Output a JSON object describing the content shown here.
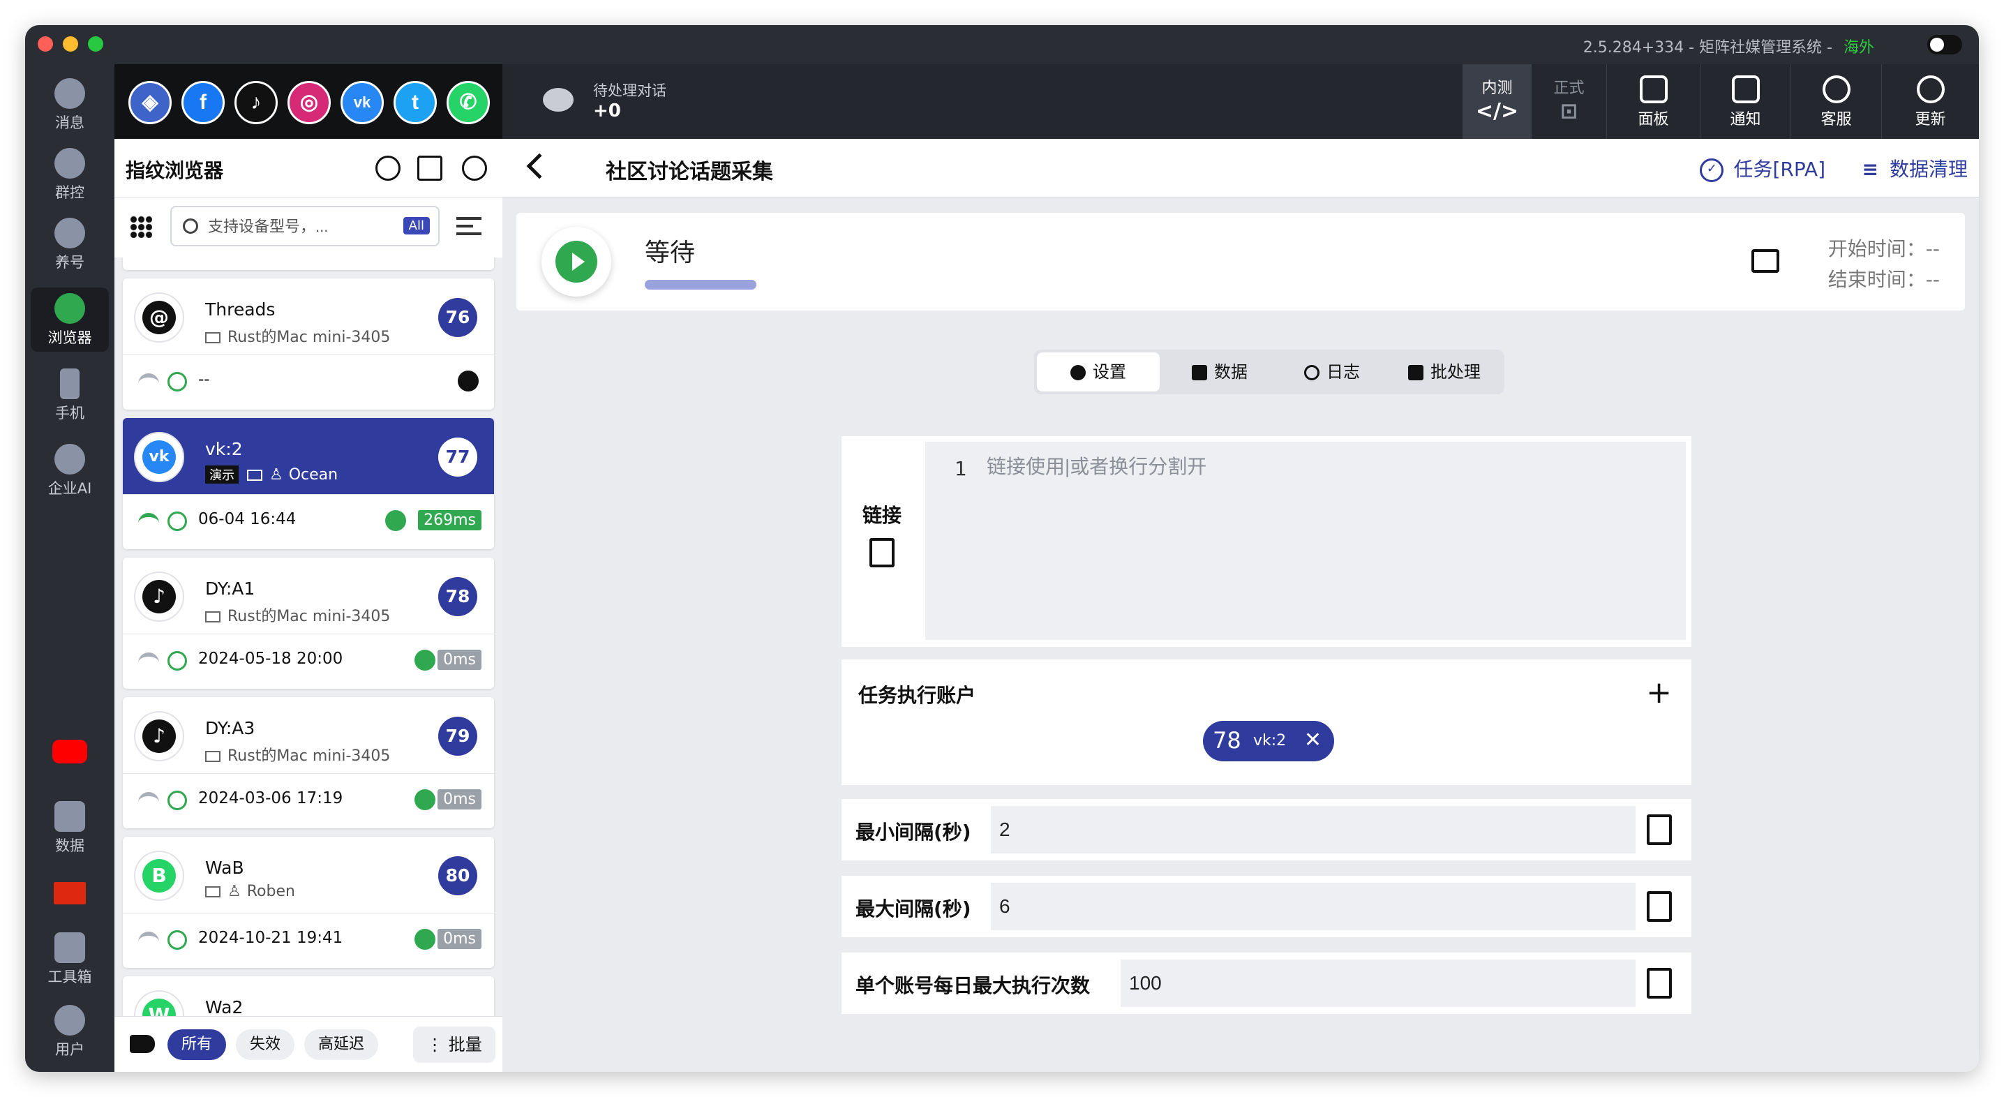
{
  "titlebar": {
    "title": "2.5.284+334 - 矩阵社媒管理系统 -",
    "region": "海外"
  },
  "rail": {
    "items": [
      {
        "label": "消息",
        "icon": "message-icon"
      },
      {
        "label": "群控",
        "icon": "group-control-icon"
      },
      {
        "label": "养号",
        "icon": "account-nurture-icon"
      },
      {
        "label": "浏览器",
        "icon": "browser-icon",
        "active": true
      },
      {
        "label": "手机",
        "icon": "phone-icon"
      },
      {
        "label": "企业AI",
        "icon": "enterprise-ai-icon"
      },
      {
        "label": "",
        "icon": "youtube-icon"
      },
      {
        "label": "数据",
        "icon": "data-chart-icon"
      },
      {
        "label": "",
        "icon": "china-flag-icon"
      },
      {
        "label": "工具箱",
        "icon": "toolbox-icon"
      },
      {
        "label": "用户",
        "icon": "user-icon"
      }
    ]
  },
  "social": [
    {
      "name": "browser-app-icon",
      "glyph": "◈",
      "color": "#3e64c9"
    },
    {
      "name": "facebook-icon",
      "glyph": "f",
      "color": "#1877f2"
    },
    {
      "name": "tiktok-icon",
      "glyph": "♪",
      "color": "#111111"
    },
    {
      "name": "instagram-icon",
      "glyph": "◎",
      "color": "#d62976"
    },
    {
      "name": "vk-icon",
      "glyph": "vk",
      "color": "#2787f5"
    },
    {
      "name": "twitter-icon",
      "glyph": "t",
      "color": "#1da1f2"
    },
    {
      "name": "whatsapp-icon",
      "glyph": "✆",
      "color": "#25d366"
    }
  ],
  "toolbar": {
    "pending_label": "待处理对话",
    "pending_count": "+0",
    "buttons": [
      {
        "top": "内测",
        "bottom": "</>",
        "active": true
      },
      {
        "top": "正式",
        "bottom": "⊡",
        "dim": true
      }
    ],
    "actions": [
      {
        "label": "面板",
        "icon": "sliders-icon"
      },
      {
        "label": "通知",
        "icon": "megaphone-icon"
      },
      {
        "label": "客服",
        "icon": "headset-icon"
      },
      {
        "label": "更新",
        "icon": "app-store-icon"
      }
    ]
  },
  "panel": {
    "title": "指纹浏览器",
    "search_placeholder": "支持设备型号，...",
    "all_badge": "All",
    "cards": [
      {
        "name": "Threads",
        "device": "Rust的Mac mini-3405",
        "num": "76",
        "date": "--",
        "latency": "",
        "avatar": "@",
        "avatar_color": "#111111",
        "selected": false,
        "demo": "",
        "user": ""
      },
      {
        "name": "vk:2",
        "device": "",
        "num": "77",
        "date": "06-04 16:44",
        "latency": "269ms",
        "avatar": "vk",
        "avatar_color": "#2787f5",
        "selected": true,
        "demo": "演示",
        "user": "Ocean"
      },
      {
        "name": "DY:A1",
        "device": "Rust的Mac mini-3405",
        "num": "78",
        "date": "2024-05-18 20:00",
        "latency": "0ms",
        "avatar": "♪",
        "avatar_color": "#111111",
        "selected": false,
        "demo": "",
        "user": ""
      },
      {
        "name": "DY:A3",
        "device": "Rust的Mac mini-3405",
        "num": "79",
        "date": "2024-03-06 17:19",
        "latency": "0ms",
        "avatar": "♪",
        "avatar_color": "#111111",
        "selected": false,
        "demo": "",
        "user": ""
      },
      {
        "name": "WaB",
        "device": "",
        "num": "80",
        "date": "2024-10-21 19:41",
        "latency": "0ms",
        "avatar": "B",
        "avatar_color": "#25d366",
        "selected": false,
        "demo": "",
        "user": "Roben"
      },
      {
        "name": "Wa2",
        "device": "",
        "num": "",
        "date": "",
        "latency": "",
        "avatar": "W",
        "avatar_color": "#25d366",
        "selected": false,
        "demo": "",
        "user": ""
      }
    ],
    "filters": [
      "所有",
      "失效",
      "高延迟"
    ],
    "batch_label": "⋮ 批量"
  },
  "main": {
    "title": "社区讨论话题采集",
    "task_rpa": "任务[RPA]",
    "data_clean": "数据清理",
    "status": "等待",
    "start_time": "开始时间：--",
    "end_time": "结束时间：--",
    "tabs": [
      "设置",
      "数据",
      "日志",
      "批处理"
    ],
    "links": {
      "label": "链接",
      "line_number": "1",
      "placeholder": "链接使用|或者换行分割开"
    },
    "accounts": {
      "label": "任务执行账户",
      "chip_num": "78",
      "chip_name": "vk:2"
    },
    "fields": [
      {
        "label": "最小间隔(秒)",
        "value": "2"
      },
      {
        "label": "最大间隔(秒)",
        "value": "6"
      },
      {
        "label": "单个账号每日最大执行次数",
        "value": "100"
      }
    ]
  }
}
